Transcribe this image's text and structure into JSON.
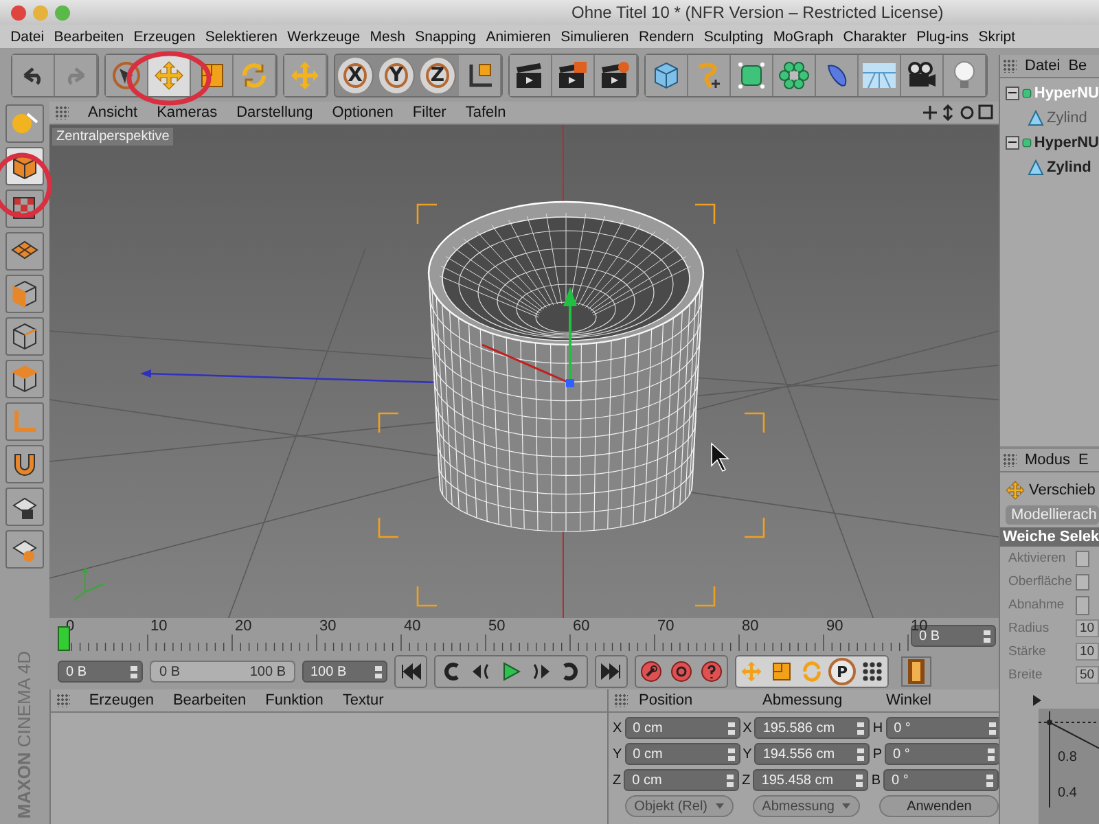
{
  "window": {
    "title": "Ohne Titel 10 * (NFR Version – Restricted License)"
  },
  "menu": [
    "Datei",
    "Bearbeiten",
    "Erzeugen",
    "Selektieren",
    "Werkzeuge",
    "Mesh",
    "Snapping",
    "Animieren",
    "Simulieren",
    "Rendern",
    "Sculpting",
    "MoGraph",
    "Charakter",
    "Plug-ins",
    "Skript"
  ],
  "toolbar": {
    "undo": {
      "disabled": false
    },
    "redo": {
      "disabled": true
    },
    "transform_tools": [
      {
        "selected": false
      },
      {
        "selected": true
      },
      {
        "selected": false
      },
      {
        "selected": false
      }
    ],
    "axis_locks": [
      {
        "label": "X",
        "on": true
      },
      {
        "label": "Y",
        "on": true
      },
      {
        "label": "Z",
        "on": true
      }
    ]
  },
  "palette": [
    {
      "selected": false
    },
    {
      "selected": true
    },
    {
      "selected": false
    },
    {
      "selected": false
    },
    {
      "selected": false
    },
    {
      "selected": false
    },
    {
      "selected": false
    },
    {
      "selected": false
    },
    {
      "selected": false
    },
    {
      "selected": false
    },
    {
      "selected": false
    }
  ],
  "viewport": {
    "menu": [
      "Ansicht",
      "Kameras",
      "Darstellung",
      "Optionen",
      "Filter",
      "Tafeln"
    ],
    "camera_label": "Zentralperspektive"
  },
  "timeline": {
    "labels": [
      "0",
      "10",
      "20",
      "30",
      "40",
      "50",
      "60",
      "70",
      "80",
      "90",
      "10"
    ],
    "level": 0,
    "current_frame": "0 B"
  },
  "transport": {
    "start": "0 B",
    "range": {
      "start": "0 B",
      "end": "100 B",
      "level": 1
    },
    "end": "100 B",
    "parameter_key_label": "P"
  },
  "material_manager": {
    "menu": [
      "Erzeugen",
      "Bearbeiten",
      "Funktion",
      "Textur"
    ]
  },
  "logo": {
    "brand": "MAXON",
    "product": "CINEMA 4D"
  },
  "coordinates": {
    "headers": [
      "Position",
      "Abmessung",
      "Winkel"
    ],
    "rows": [
      {
        "axis": "X",
        "position": "0 cm",
        "size_axis": "X",
        "size": "195.586 cm",
        "angle_axis": "H",
        "angle": "0 °"
      },
      {
        "axis": "Y",
        "position": "0 cm",
        "size_axis": "Y",
        "size": "194.556 cm",
        "angle_axis": "P",
        "angle": "0 °"
      },
      {
        "axis": "Z",
        "position": "0 cm",
        "size_axis": "Z",
        "size": "195.458 cm",
        "angle_axis": "B",
        "angle": "0 °"
      }
    ],
    "buttons": [
      "Objekt (Rel)",
      "Abmessung",
      "Anwenden"
    ]
  },
  "object_manager": {
    "menu": [
      "Datei",
      "Be"
    ],
    "tree": [
      {
        "name": "HyperNU",
        "selected": true,
        "expanded": true,
        "children": [
          {
            "name": "Zylind",
            "disabled": true
          }
        ]
      },
      {
        "name": "HyperNU",
        "selected": false,
        "expanded": true,
        "children": [
          {
            "name": "Zylind",
            "disabled": false
          }
        ]
      }
    ]
  },
  "attribute_manager": {
    "menu": [
      "Modus",
      "E"
    ],
    "tool": "Verschieb",
    "tab": "Modellierach",
    "section": "Weiche Selek",
    "fields": [
      {
        "label": "Aktivieren",
        "kind": "checkbox",
        "checked": false
      },
      {
        "label": "Oberfläche",
        "kind": "checkbox",
        "checked": false
      },
      {
        "label": "Abnahme",
        "kind": "dropdown"
      },
      {
        "label": "Radius",
        "kind": "number",
        "value": "10"
      },
      {
        "label": "Stärke",
        "kind": "number",
        "value": "10"
      },
      {
        "label": "Breite",
        "kind": "number",
        "value": "50"
      }
    ],
    "graph_labels": [
      "0.8",
      "0.4"
    ]
  }
}
